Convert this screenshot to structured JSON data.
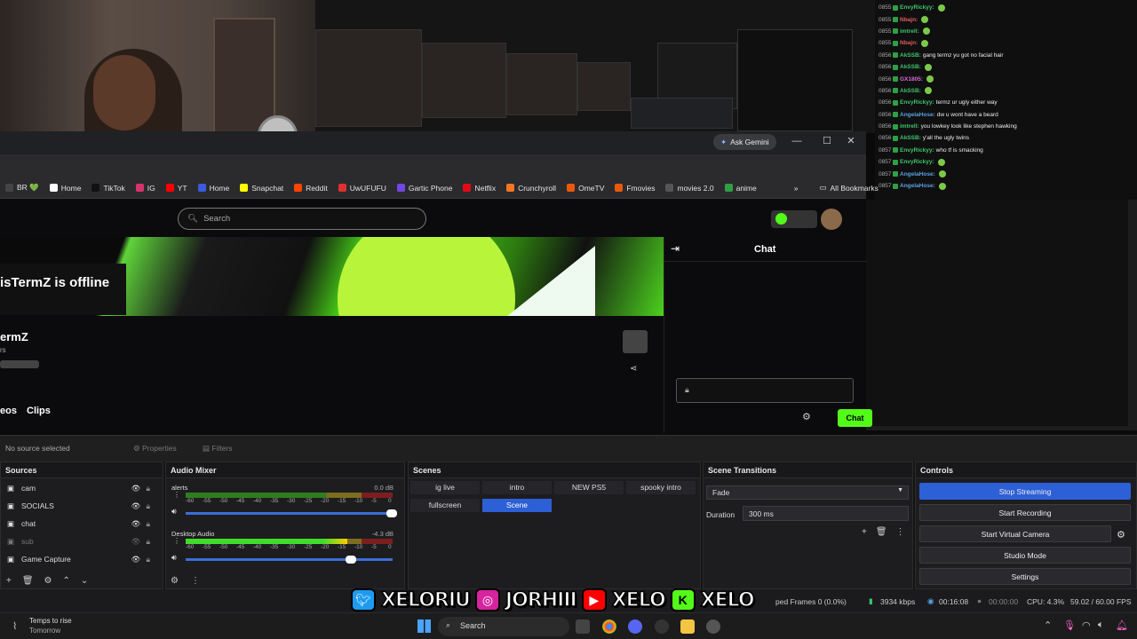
{
  "chatlog": {
    "rows": [
      {
        "time": "0855",
        "name": "EnvyRickyy:",
        "color": "#3ec46d",
        "msg": "",
        "emote": true
      },
      {
        "time": "0855",
        "name": "Nbajn:",
        "color": "#e05d5d",
        "msg": "",
        "emote": true
      },
      {
        "time": "0855",
        "name": "imtrell:",
        "color": "#3ec46d",
        "msg": "",
        "emote": true
      },
      {
        "time": "0855",
        "name": "Nbajn:",
        "color": "#e05d5d",
        "msg": "",
        "emote": true
      },
      {
        "time": "0856",
        "name": "AkSSB:",
        "color": "#3ec46d",
        "msg": "gang termz yu got no facial hair",
        "emote": false
      },
      {
        "time": "0856",
        "name": "AkSSB:",
        "color": "#3ec46d",
        "msg": "",
        "emote": true
      },
      {
        "time": "0856",
        "name": "GX1805:",
        "color": "#d06ad8",
        "msg": "",
        "emote": true
      },
      {
        "time": "0856",
        "name": "AkSSB:",
        "color": "#3ec46d",
        "msg": "",
        "emote": true
      },
      {
        "time": "0856",
        "name": "EnvyRickyy:",
        "color": "#3ec46d",
        "msg": "termz ur ugly either way",
        "emote": false
      },
      {
        "time": "0856",
        "name": "AngelaHose:",
        "color": "#5aa0e6",
        "msg": "dw u wont have a beard",
        "emote": false
      },
      {
        "time": "0856",
        "name": "imtrell:",
        "color": "#3ec46d",
        "msg": "you lowkey look like stephen hawking",
        "emote": false
      },
      {
        "time": "0856",
        "name": "AkSSB:",
        "color": "#3ec46d",
        "msg": "y'all the ugly twins",
        "emote": false
      },
      {
        "time": "0857",
        "name": "EnvyRickyy:",
        "color": "#3ec46d",
        "msg": "who tf is smacking",
        "emote": false
      },
      {
        "time": "0857",
        "name": "EnvyRickyy:",
        "color": "#3ec46d",
        "msg": "",
        "emote": true
      },
      {
        "time": "0857",
        "name": "AngelaHose:",
        "color": "#5aa0e6",
        "msg": "",
        "emote": true
      },
      {
        "time": "0857",
        "name": "AngelaHose:",
        "color": "#5aa0e6",
        "msg": "",
        "emote": true
      }
    ]
  },
  "browser": {
    "gemini_label": "Ask Gemini",
    "bookmarks": [
      {
        "label": "BR 💚",
        "color": "#444"
      },
      {
        "label": "Home",
        "color": "#fff"
      },
      {
        "label": "TikTok",
        "color": "#111"
      },
      {
        "label": "IG",
        "color": "#d6336c"
      },
      {
        "label": "YT",
        "color": "#ff0000"
      },
      {
        "label": "Home",
        "color": "#3b5bdb"
      },
      {
        "label": "Snapchat",
        "color": "#fffc00"
      },
      {
        "label": "Reddit",
        "color": "#ff4500"
      },
      {
        "label": "UwUFUFU",
        "color": "#e03131"
      },
      {
        "label": "Gartic Phone",
        "color": "#7048e8"
      },
      {
        "label": "Netflix",
        "color": "#e50914"
      },
      {
        "label": "Crunchyroll",
        "color": "#f47521"
      },
      {
        "label": "OmeTV",
        "color": "#e8590c"
      },
      {
        "label": "Fmovies",
        "color": "#e8590c"
      },
      {
        "label": "movies 2.0",
        "color": "#555"
      },
      {
        "label": "anime",
        "color": "#2f9e44"
      }
    ],
    "all_bookmarks": "All Bookmarks"
  },
  "kick": {
    "search_placeholder": "Search",
    "offline_text": "isTermZ is offline",
    "channel_name": "ermZ",
    "channel_sub": "rs",
    "tab_videos": "eos",
    "tab_clips": "Clips",
    "chat_title": "Chat",
    "chat_button": "Chat"
  },
  "obs": {
    "no_source": "No source selected",
    "properties": "Properties",
    "filters": "Filters",
    "sources_title": "Sources",
    "sources": [
      {
        "name": "cam",
        "visible": true
      },
      {
        "name": "SOCIALS",
        "visible": true
      },
      {
        "name": "chat",
        "visible": true
      },
      {
        "name": "sub",
        "visible": false
      },
      {
        "name": "Game Capture",
        "visible": true
      }
    ],
    "mixer_title": "Audio Mixer",
    "mixer": [
      {
        "name": "alerts",
        "db": "0.0 dB",
        "level": 0
      },
      {
        "name": "Desktop Audio",
        "db": "-4.3 dB",
        "level": 0.78
      }
    ],
    "meter_ticks": [
      "-60",
      "-55",
      "-50",
      "-45",
      "-40",
      "-35",
      "-30",
      "-25",
      "-20",
      "-15",
      "-10",
      "-5",
      "0"
    ],
    "scenes_title": "Scenes",
    "scenes": [
      "ig live",
      "intro",
      "NEW PS5",
      "spooky intro",
      "fullscreen",
      "Scene"
    ],
    "active_scene": "Scene",
    "transitions_title": "Scene Transitions",
    "transition": "Fade",
    "duration_label": "Duration",
    "duration": "300 ms",
    "controls_title": "Controls",
    "controls": [
      "Stop Streaming",
      "Start Recording",
      "Start Virtual Camera",
      "Studio Mode",
      "Settings"
    ],
    "status": {
      "dropped": "ped Frames 0 (0.0%)",
      "kbps": "3934 kbps",
      "live_time": "00:16:08",
      "rec_time": "00:00:00",
      "cpu": "CPU: 4.3%",
      "fps": "59.02 / 60.00 FPS"
    }
  },
  "socials": [
    "XELORIU",
    "JORHIII",
    "XELO",
    "XELO"
  ],
  "taskbar": {
    "weather_title": "Temps to rise",
    "weather_sub": "Tomorrow",
    "search": "Search"
  }
}
